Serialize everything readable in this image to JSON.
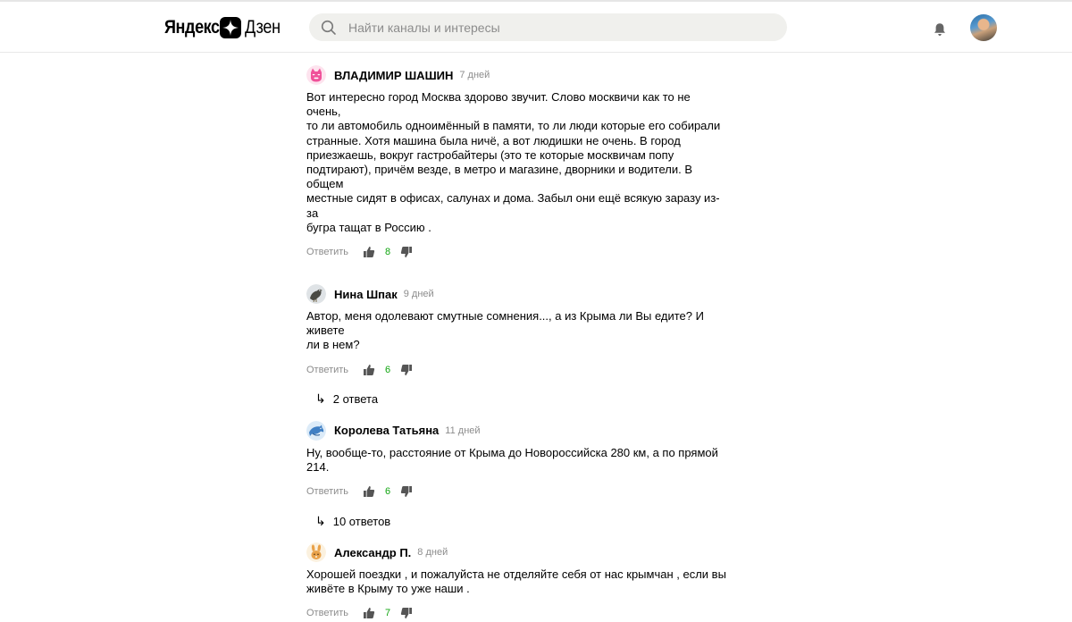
{
  "header": {
    "logo_part1": "Яндекс",
    "logo_part2": "Дзен",
    "search_placeholder": "Найти каналы и интересы",
    "icons": [
      "star-logo-icon",
      "search-icon",
      "bell-icon",
      "user-avatar"
    ]
  },
  "comments": [
    {
      "author": "ВЛАДИМИР ШАШИН",
      "time": "7 дней",
      "text_lines": [
        "Вот интересно город Москва здорово звучит. Слово москвичи как то не очень,",
        "то ли автомобиль одноимённый в памяти, то ли люди которые его собирали",
        "странные. Хотя машина была ничё, а вот людишки не очень. В город",
        "приезжаешь, вокруг гастробайтеры (это те которые москвичам попу",
        "подтирают), причём везде, в метро и магазине, дворники и водители. В общем",
        "местные сидят в офисах, салунах и дома. Забыл они ещё всякую заразу из-за",
        "бугра тащат в Россию ."
      ],
      "reply_label": "Ответить",
      "likes": "8",
      "avatar": "pink-cat-avatar"
    },
    {
      "author": "Нина Шпак",
      "time": "9 дней",
      "text_lines": [
        "Автор, меня одолевают смутные сомнения..., а из Крыма ли Вы едите? И живете",
        "ли в нем?"
      ],
      "reply_label": "Ответить",
      "likes": "6",
      "replies": "2 ответа",
      "avatar": "bird-avatar"
    },
    {
      "author": "Королева Татьяна",
      "time": "11 дней",
      "text_lines": [
        "Ну, вообще-то, расстояние от Крыма до Новороссийска 280 км, а по прямой",
        "214."
      ],
      "reply_label": "Ответить",
      "likes": "6",
      "replies": "10 ответов",
      "avatar": "blue-dolphin-avatar"
    },
    {
      "author": "Александр П.",
      "time": "8 дней",
      "text_lines": [
        "Хорошей поездки , и пожалуйста не отделяйте себя от нас крымчан , если вы",
        "живёте в Крыму то уже наши ."
      ],
      "reply_label": "Ответить",
      "likes": "7",
      "avatar": "bunny-avatar"
    }
  ],
  "colors": {
    "like_count": "#10a510",
    "muted_text": "#8c8c8c",
    "search_bg": "#f0f0ed"
  }
}
